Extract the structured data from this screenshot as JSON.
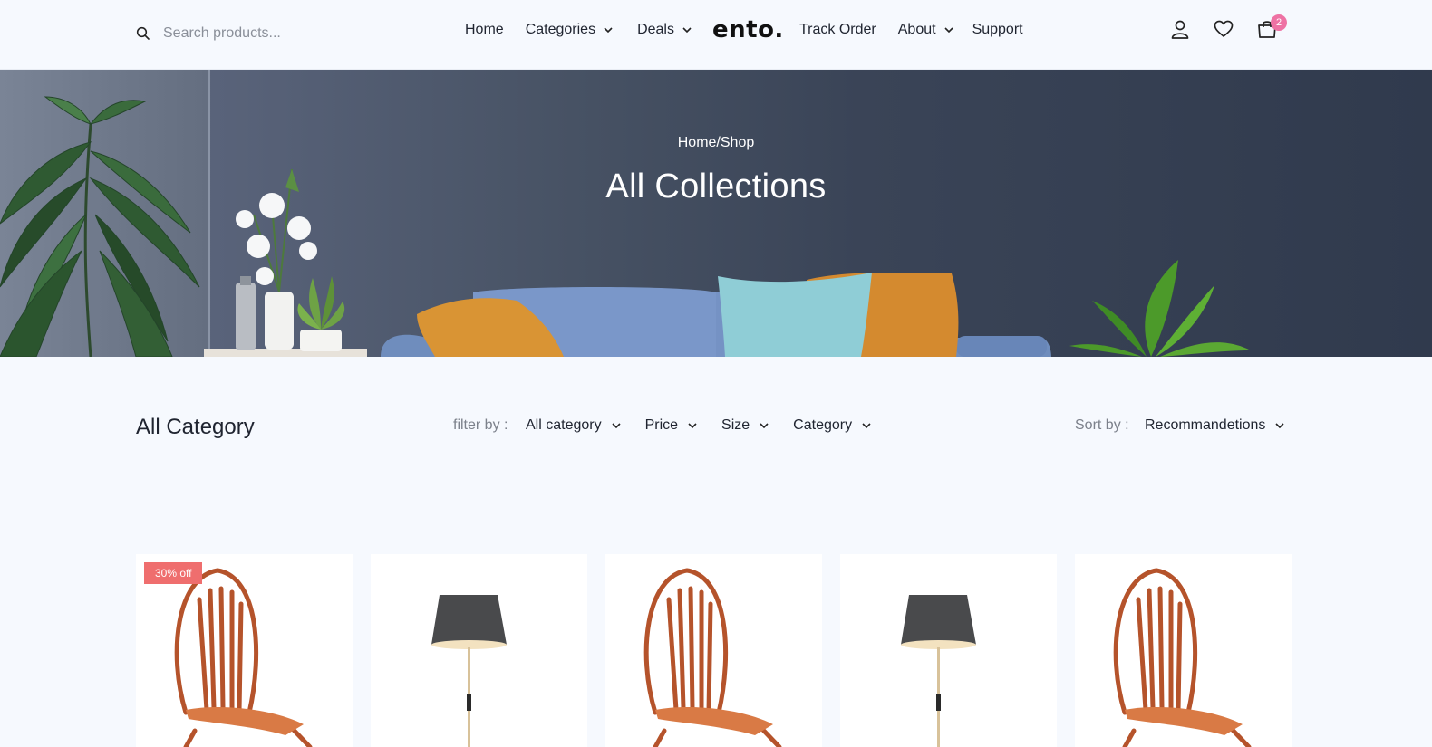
{
  "header": {
    "search": {
      "placeholder": "Search products..."
    },
    "logo": "ento.",
    "nav_left": [
      {
        "label": "Home",
        "dropdown": false
      },
      {
        "label": "Categories",
        "dropdown": true
      },
      {
        "label": "Deals",
        "dropdown": true
      }
    ],
    "nav_right": [
      {
        "label": "Track Order",
        "dropdown": false
      },
      {
        "label": "About",
        "dropdown": true
      },
      {
        "label": "Support",
        "dropdown": false
      }
    ],
    "icons": [
      "user-icon",
      "heart-icon",
      "shopping-bag-icon"
    ],
    "cart_count": "2"
  },
  "hero": {
    "breadcrumb": "Home/Shop",
    "title": "All Collections"
  },
  "filters": {
    "section_title": "All Category",
    "filter_label": "filter by :",
    "dropdowns": [
      "All category",
      "Price",
      "Size",
      "Category"
    ],
    "sort_label": "Sort by :",
    "sort_value": "Recommandetions"
  },
  "products": [
    {
      "type": "chair",
      "badge": "30% off"
    },
    {
      "type": "lamp",
      "badge": ""
    },
    {
      "type": "chair",
      "badge": ""
    },
    {
      "type": "lamp",
      "badge": ""
    },
    {
      "type": "chair",
      "badge": ""
    }
  ],
  "colors": {
    "background": "#f6f9fe",
    "badge_pink": "#ee72a4",
    "sale_red": "#ef6e6e",
    "hero_dark": "#303a4d"
  }
}
